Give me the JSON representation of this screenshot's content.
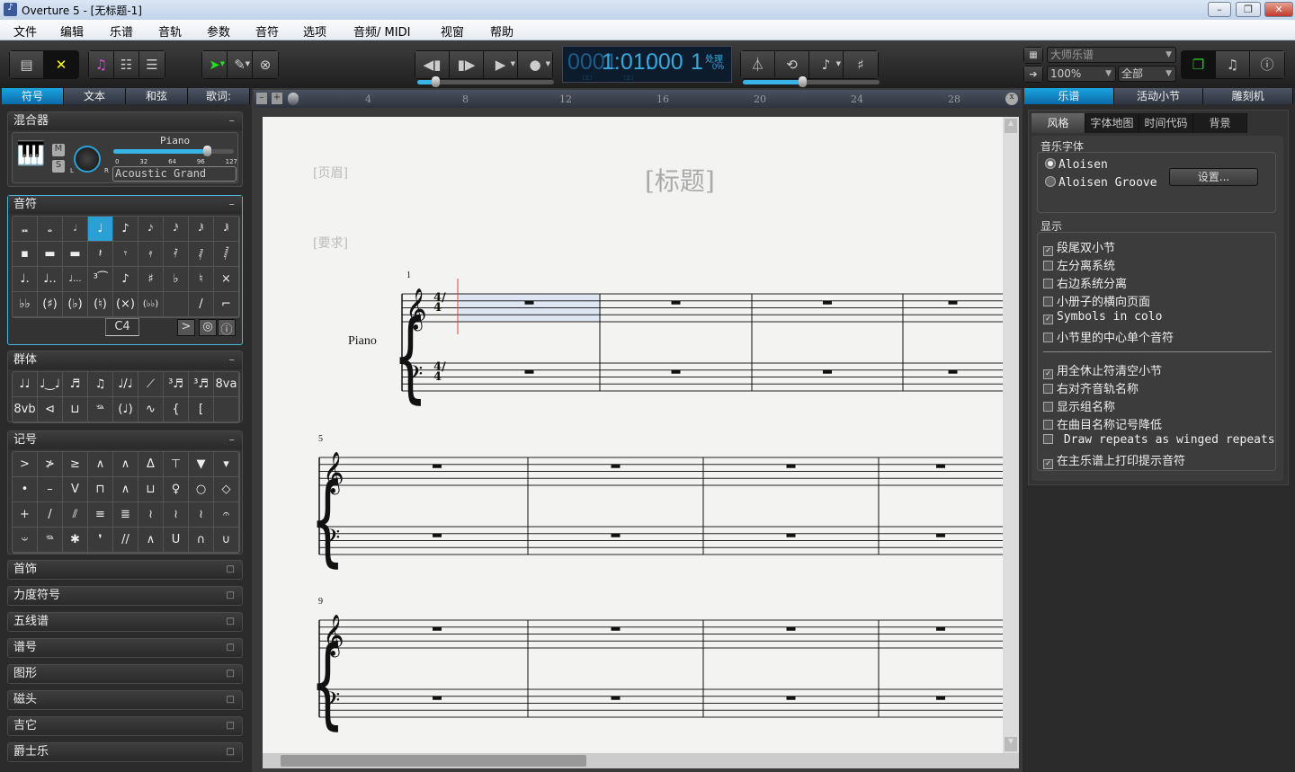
{
  "window": {
    "title": "Overture 5 - [无标题-1]",
    "app_icon": "overture-icon"
  },
  "menu": [
    "文件",
    "编辑",
    "乐谱",
    "音轨",
    "参数",
    "音符",
    "选项",
    "音频/ MIDI",
    "视窗",
    "帮助"
  ],
  "transport": {
    "lcd_measure": "0001",
    "lcd_beat": "1:01:",
    "lcd_tick": "000",
    "lcd_track": "1",
    "lcd_processing": "处理",
    "lcd_percent": "0%",
    "lcd_sub1": "□□",
    "lcd_sub2": "□□",
    "position_slider": 0.15,
    "tempo_slider": 0.45
  },
  "view": {
    "layout_combo": "大师乐谱",
    "zoom_combo": "100%",
    "tracks_combo": "全部"
  },
  "left_tabs": [
    "符号",
    "文本",
    "和弦",
    "歌词:"
  ],
  "mixer": {
    "title": "混合器",
    "track": "Piano",
    "mute": "M",
    "solo": "S",
    "pan_l": "L",
    "pan_r": "R",
    "scale": [
      "0",
      "32",
      "64",
      "96",
      "127"
    ],
    "volume": 100,
    "instrument": "Acoustic Grand"
  },
  "notes_panel": {
    "title": "音符",
    "pitch": "C4",
    "cells": [
      "breve",
      "whole",
      "half",
      "quarter",
      "eighth",
      "16th",
      "32nd",
      "64th",
      "128th",
      "breve-rest",
      "whole-rest",
      "half-rest",
      "quarter-rest",
      "eighth-rest",
      "16th-rest",
      "32nd-rest",
      "64th-rest",
      "128th-rest",
      "dot",
      "double-dot",
      "triple-dot",
      "triplet",
      "grace",
      "sharp",
      "flat",
      "natural",
      "double-sharp",
      "double-flat",
      "paren-sharp",
      "paren-flat",
      "paren-natural",
      "paren-double-sharp",
      "paren-double-flat",
      "",
      "slash",
      "flag"
    ],
    "selected": 3
  },
  "groups_panel": {
    "title": "群体",
    "cells": [
      "beam-dotted",
      "tie",
      "slur-triplet",
      "slur-group",
      "gliss",
      "gliss2",
      "tuplet-3",
      "tuplet-3b",
      "ottava-up",
      "ottava-down",
      "hairpin",
      "bracket-line",
      "pedal",
      "paren-notes",
      "trill-line",
      "brace",
      "bracket",
      ""
    ]
  },
  "marks_panel": {
    "title": "记号",
    "cells": [
      "accent",
      "accent2",
      "accent3",
      "marcato",
      "marcato2",
      "marcato3",
      "tenuto-staccato",
      "wedge",
      "wedge-small",
      "staccato",
      "tenuto",
      "up-bow",
      "down-bow",
      "marcato4",
      "open-bow",
      "harmonic",
      "open",
      "diamond",
      "plus",
      "trem1",
      "trem2",
      "trem3",
      "trem4",
      "arpeggio",
      "arpeggio-up",
      "arpeggio-down",
      "fermata",
      "fermata-down",
      "pedal",
      "pedal-release",
      "breath",
      "caesura",
      "marcato5",
      "u-turn",
      "turn",
      "inv-turn"
    ]
  },
  "collapsed_panels": [
    "首饰",
    "力度符号",
    "五线谱",
    "谱号",
    "图形",
    "磁头",
    "吉它",
    "爵士乐"
  ],
  "ruler": {
    "marks": [
      "4",
      "8",
      "12",
      "16",
      "20",
      "24",
      "28"
    ]
  },
  "score": {
    "header_placeholder": "[页眉]",
    "title_placeholder": "[标题]",
    "instruction_placeholder": "[要求]",
    "instrument": "Piano",
    "time_sig": "4/4",
    "systems": [
      {
        "measure": "1"
      },
      {
        "measure": "5"
      },
      {
        "measure": "9"
      }
    ]
  },
  "right_tabs": [
    "乐谱",
    "活动小节",
    "雕刻机"
  ],
  "style_tabs": [
    "风格",
    "字体地图",
    "时间代码",
    "背景"
  ],
  "font_group": {
    "title": "音乐字体",
    "options": [
      {
        "label": "Aloisen",
        "selected": true
      },
      {
        "label": "Aloisen Groove",
        "selected": false
      }
    ],
    "setup_button": "设置..."
  },
  "display_group": {
    "title": "显示",
    "options": [
      {
        "label": "段尾双小节",
        "checked": true
      },
      {
        "label": "左分离系统",
        "checked": false
      },
      {
        "label": "右边系统分离",
        "checked": false
      },
      {
        "label": "小册子的横向页面",
        "checked": false
      },
      {
        "label": "Symbols in colo",
        "checked": true
      },
      {
        "label": "小节里的中心单个音符",
        "checked": false
      }
    ],
    "options2": [
      {
        "label": "用全休止符清空小节",
        "checked": true
      },
      {
        "label": "右对齐音轨名称",
        "checked": false
      },
      {
        "label": "显示组名称",
        "checked": false
      },
      {
        "label": "在曲目名称记号降低",
        "checked": false
      },
      {
        "label": " Draw repeats as winged repeats",
        "checked": false
      },
      {
        "label": "在主乐谱上打印提示音符",
        "checked": true
      }
    ]
  },
  "colors": {
    "accent": "#2aa0d4",
    "lcd": "#3aa7dc",
    "selection": "#dde6f2",
    "cursor": "#e04040"
  }
}
